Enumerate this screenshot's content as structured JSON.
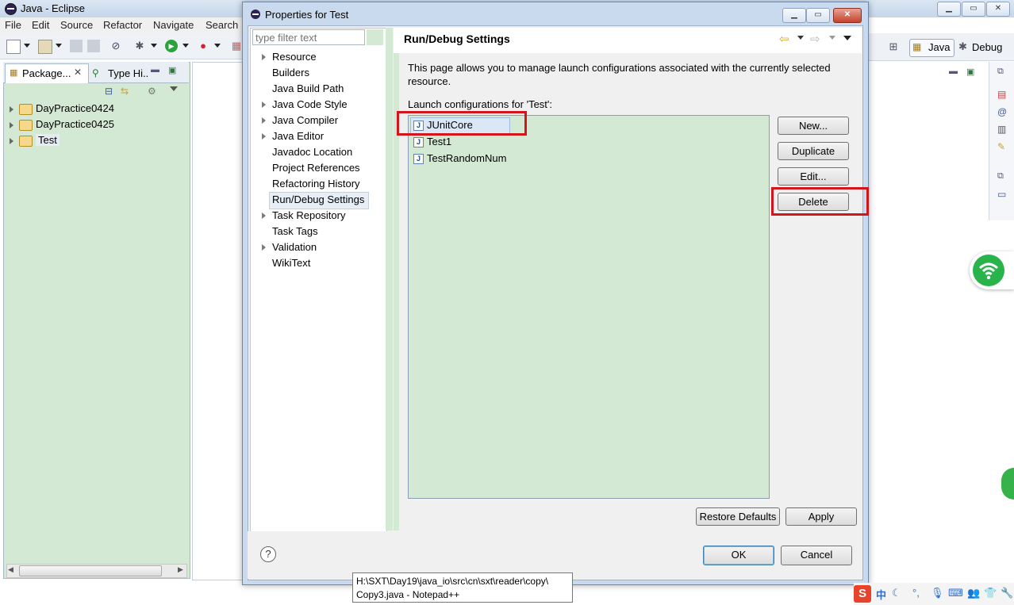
{
  "eclipse": {
    "title": "Java - Eclipse",
    "menu": [
      "File",
      "Edit",
      "Source",
      "Refactor",
      "Navigate",
      "Search"
    ],
    "perspectives": {
      "java": "Java",
      "debug": "Debug"
    },
    "package_tab": "Package...",
    "type_tab": "Type Hi..",
    "projects": [
      "DayPractice0424",
      "DayPractice0425",
      "Test"
    ]
  },
  "dialog": {
    "title": "Properties for Test",
    "filter_placeholder": "type filter text",
    "nav_items": [
      {
        "label": "Resource",
        "expandable": true
      },
      {
        "label": "Builders",
        "expandable": false
      },
      {
        "label": "Java Build Path",
        "expandable": false
      },
      {
        "label": "Java Code Style",
        "expandable": true
      },
      {
        "label": "Java Compiler",
        "expandable": true
      },
      {
        "label": "Java Editor",
        "expandable": true
      },
      {
        "label": "Javadoc Location",
        "expandable": false
      },
      {
        "label": "Project References",
        "expandable": false
      },
      {
        "label": "Refactoring History",
        "expandable": false
      },
      {
        "label": "Run/Debug Settings",
        "expandable": false,
        "selected": true
      },
      {
        "label": "Task Repository",
        "expandable": true
      },
      {
        "label": "Task Tags",
        "expandable": false
      },
      {
        "label": "Validation",
        "expandable": true
      },
      {
        "label": "WikiText",
        "expandable": false
      }
    ],
    "page_title": "Run/Debug Settings",
    "description": "This page allows you to manage launch configurations associated with the currently selected resource.",
    "launch_label": "Launch configurations for 'Test':",
    "configs": [
      "JUnitCore",
      "Test1",
      "TestRandomNum"
    ],
    "buttons": {
      "new": "New...",
      "duplicate": "Duplicate",
      "edit": "Edit...",
      "delete": "Delete",
      "restore": "Restore Defaults",
      "apply": "Apply",
      "ok": "OK",
      "cancel": "Cancel"
    }
  },
  "tooltip": {
    "line1": "H:\\SXT\\Day19\\java_io\\src\\cn\\sxt\\reader\\copy\\",
    "line2": "Copy3.java - Notepad++"
  },
  "tray": {
    "ime": "中"
  },
  "colors": {
    "highlight_box": "#d2161b",
    "panel_green": "#d4e9d3"
  }
}
